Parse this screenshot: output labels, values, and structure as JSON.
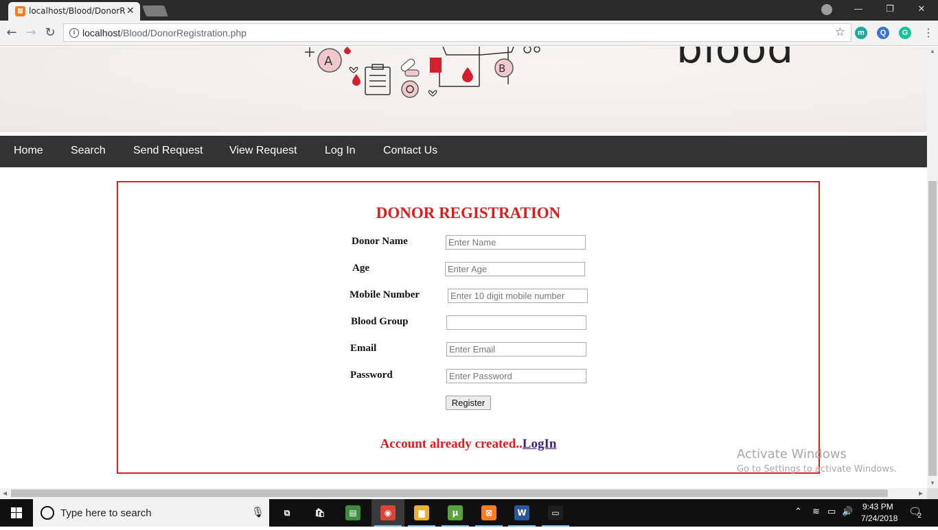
{
  "browser": {
    "tab_title": "localhost/Blood/DonorRe",
    "tab_close": "✕",
    "url_host": "localhost",
    "url_path": "/Blood/DonorRegistration.php",
    "window_controls": {
      "minimize": "—",
      "restore": "❐",
      "close": "✕"
    },
    "back": "←",
    "forward": "→",
    "reload": "↻",
    "info": "i",
    "star": "☆",
    "menu": "⋮",
    "extensions": [
      {
        "name": "m-extension-icon",
        "glyph": "m",
        "color": "#1ba99a"
      },
      {
        "name": "search-extension-icon",
        "glyph": "Q",
        "color": "#3c74d6"
      },
      {
        "name": "grammarly-icon",
        "glyph": "G",
        "color": "#15c39a"
      }
    ]
  },
  "banner": {
    "word": "blood"
  },
  "nav": {
    "items": [
      "Home",
      "Search",
      "Send Request",
      "View Request",
      "Log In",
      "Contact Us"
    ]
  },
  "form": {
    "title": "DONOR REGISTRATION",
    "fields": [
      {
        "label": "Donor Name",
        "placeholder": "Enter Name",
        "value": ""
      },
      {
        "label": "Age",
        "placeholder": "Enter Age",
        "value": ""
      },
      {
        "label": "Mobile Number",
        "placeholder": "Enter 10 digit mobile number",
        "value": ""
      },
      {
        "label": "Blood Group",
        "placeholder": "",
        "value": ""
      },
      {
        "label": "Email",
        "placeholder": "Enter Email",
        "value": ""
      },
      {
        "label": "Password",
        "placeholder": "Enter Password",
        "value": ""
      }
    ],
    "register_label": "Register",
    "account_text": "Account already created..",
    "login_link": "LogIn"
  },
  "watermark": {
    "title": "Activate Windows",
    "subtitle": "Go to Settings to activate Windows."
  },
  "taskbar": {
    "search_placeholder": "Type here to search",
    "mic": "🎙",
    "time": "9:43 PM",
    "date": "7/24/2018",
    "notifications": "2",
    "apps": [
      {
        "name": "task-view-icon",
        "glyph": "⧉",
        "color": "#101010"
      },
      {
        "name": "store-icon",
        "glyph": "🛍",
        "color": "#101010"
      },
      {
        "name": "chart-app-icon",
        "glyph": "▤",
        "color": "#3d8b3d"
      },
      {
        "name": "chrome-icon",
        "glyph": "◉",
        "color": "#db4437"
      },
      {
        "name": "file-explorer-icon",
        "glyph": "▆",
        "color": "#e8b230"
      },
      {
        "name": "utorrent-icon",
        "glyph": "µ",
        "color": "#57a33a"
      },
      {
        "name": "xampp-icon",
        "glyph": "⊠",
        "color": "#fb7a24"
      },
      {
        "name": "word-icon",
        "glyph": "W",
        "color": "#2b5797"
      },
      {
        "name": "mysql-icon",
        "glyph": "▭",
        "color": "#1e1e1e"
      }
    ],
    "tray": {
      "chevron": "⌃",
      "network": "≋",
      "battery": "▭",
      "volume": "🔊",
      "notification": "🗨"
    }
  }
}
